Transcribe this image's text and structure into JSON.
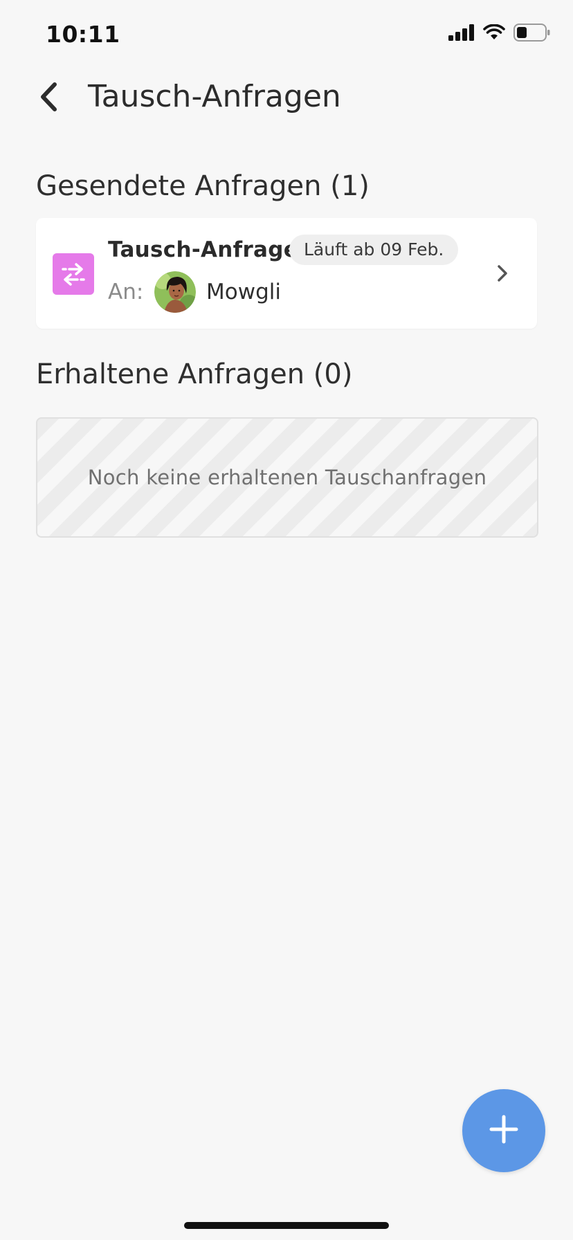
{
  "status_bar": {
    "time": "10:11",
    "icons": [
      "signal-icon",
      "wifi-icon",
      "battery-icon"
    ]
  },
  "header": {
    "title": "Tausch-Anfragen",
    "back_icon": "chevron-left-icon"
  },
  "sent": {
    "section_title": "Gesendete Anfragen (1)",
    "requests": [
      {
        "title": "Tausch-Anfrage",
        "badge": "Läuft ab 09 Feb.",
        "recipient_label": "An:",
        "recipient_name": "Mowgli",
        "icon": "swap-arrows-icon",
        "icon_color": "#e57ae9"
      }
    ]
  },
  "received": {
    "section_title": "Erhaltene Anfragen (0)",
    "empty_text": "Noch keine erhaltenen Tauschanfragen"
  },
  "fab": {
    "icon": "plus-icon",
    "color": "#5c97e6"
  },
  "colors": {
    "background": "#f7f7f7",
    "card": "#ffffff",
    "accent_blue": "#5c97e6",
    "swap_pink": "#e57ae9"
  }
}
